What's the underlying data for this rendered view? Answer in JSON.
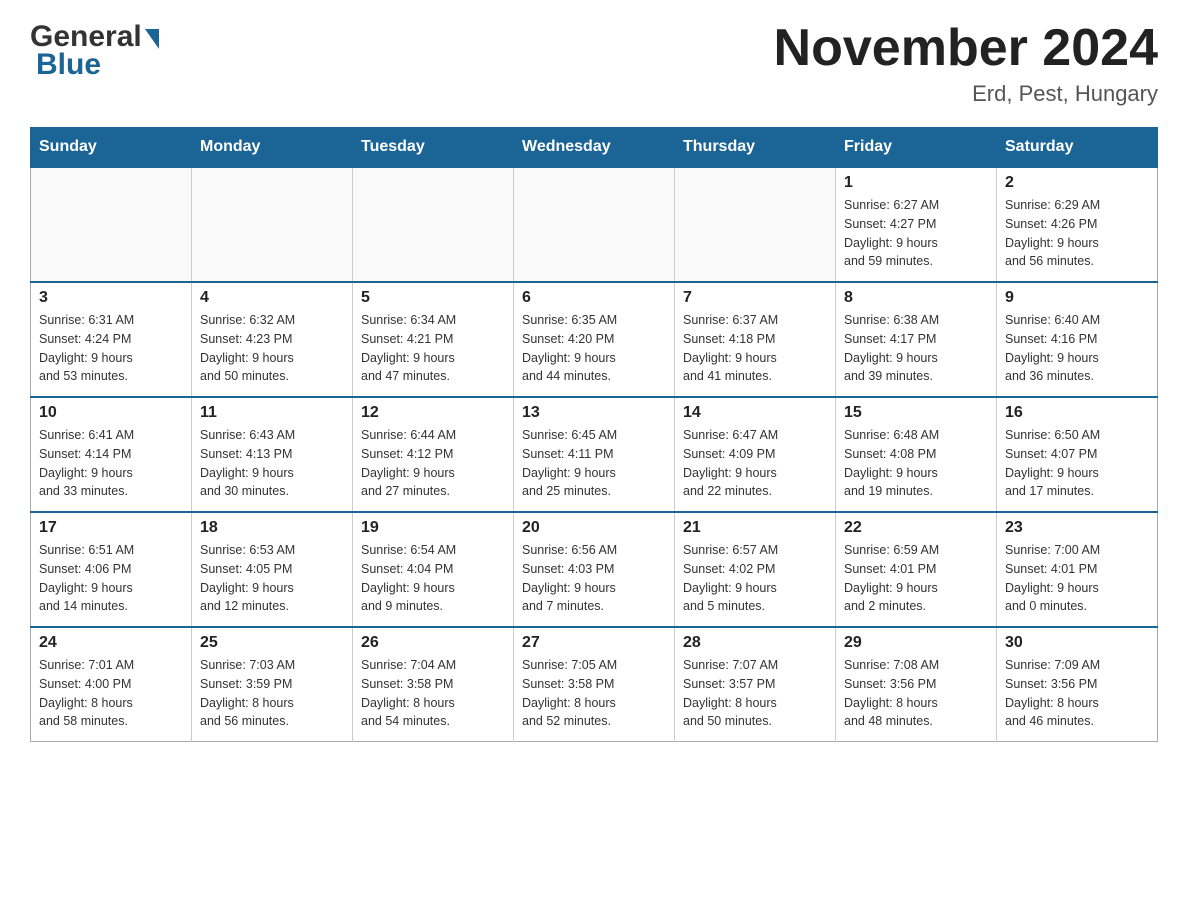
{
  "logo": {
    "text_general": "General",
    "text_blue": "Blue"
  },
  "title": "November 2024",
  "subtitle": "Erd, Pest, Hungary",
  "weekdays": [
    "Sunday",
    "Monday",
    "Tuesday",
    "Wednesday",
    "Thursday",
    "Friday",
    "Saturday"
  ],
  "weeks": [
    [
      {
        "day": "",
        "info": ""
      },
      {
        "day": "",
        "info": ""
      },
      {
        "day": "",
        "info": ""
      },
      {
        "day": "",
        "info": ""
      },
      {
        "day": "",
        "info": ""
      },
      {
        "day": "1",
        "info": "Sunrise: 6:27 AM\nSunset: 4:27 PM\nDaylight: 9 hours\nand 59 minutes."
      },
      {
        "day": "2",
        "info": "Sunrise: 6:29 AM\nSunset: 4:26 PM\nDaylight: 9 hours\nand 56 minutes."
      }
    ],
    [
      {
        "day": "3",
        "info": "Sunrise: 6:31 AM\nSunset: 4:24 PM\nDaylight: 9 hours\nand 53 minutes."
      },
      {
        "day": "4",
        "info": "Sunrise: 6:32 AM\nSunset: 4:23 PM\nDaylight: 9 hours\nand 50 minutes."
      },
      {
        "day": "5",
        "info": "Sunrise: 6:34 AM\nSunset: 4:21 PM\nDaylight: 9 hours\nand 47 minutes."
      },
      {
        "day": "6",
        "info": "Sunrise: 6:35 AM\nSunset: 4:20 PM\nDaylight: 9 hours\nand 44 minutes."
      },
      {
        "day": "7",
        "info": "Sunrise: 6:37 AM\nSunset: 4:18 PM\nDaylight: 9 hours\nand 41 minutes."
      },
      {
        "day": "8",
        "info": "Sunrise: 6:38 AM\nSunset: 4:17 PM\nDaylight: 9 hours\nand 39 minutes."
      },
      {
        "day": "9",
        "info": "Sunrise: 6:40 AM\nSunset: 4:16 PM\nDaylight: 9 hours\nand 36 minutes."
      }
    ],
    [
      {
        "day": "10",
        "info": "Sunrise: 6:41 AM\nSunset: 4:14 PM\nDaylight: 9 hours\nand 33 minutes."
      },
      {
        "day": "11",
        "info": "Sunrise: 6:43 AM\nSunset: 4:13 PM\nDaylight: 9 hours\nand 30 minutes."
      },
      {
        "day": "12",
        "info": "Sunrise: 6:44 AM\nSunset: 4:12 PM\nDaylight: 9 hours\nand 27 minutes."
      },
      {
        "day": "13",
        "info": "Sunrise: 6:45 AM\nSunset: 4:11 PM\nDaylight: 9 hours\nand 25 minutes."
      },
      {
        "day": "14",
        "info": "Sunrise: 6:47 AM\nSunset: 4:09 PM\nDaylight: 9 hours\nand 22 minutes."
      },
      {
        "day": "15",
        "info": "Sunrise: 6:48 AM\nSunset: 4:08 PM\nDaylight: 9 hours\nand 19 minutes."
      },
      {
        "day": "16",
        "info": "Sunrise: 6:50 AM\nSunset: 4:07 PM\nDaylight: 9 hours\nand 17 minutes."
      }
    ],
    [
      {
        "day": "17",
        "info": "Sunrise: 6:51 AM\nSunset: 4:06 PM\nDaylight: 9 hours\nand 14 minutes."
      },
      {
        "day": "18",
        "info": "Sunrise: 6:53 AM\nSunset: 4:05 PM\nDaylight: 9 hours\nand 12 minutes."
      },
      {
        "day": "19",
        "info": "Sunrise: 6:54 AM\nSunset: 4:04 PM\nDaylight: 9 hours\nand 9 minutes."
      },
      {
        "day": "20",
        "info": "Sunrise: 6:56 AM\nSunset: 4:03 PM\nDaylight: 9 hours\nand 7 minutes."
      },
      {
        "day": "21",
        "info": "Sunrise: 6:57 AM\nSunset: 4:02 PM\nDaylight: 9 hours\nand 5 minutes."
      },
      {
        "day": "22",
        "info": "Sunrise: 6:59 AM\nSunset: 4:01 PM\nDaylight: 9 hours\nand 2 minutes."
      },
      {
        "day": "23",
        "info": "Sunrise: 7:00 AM\nSunset: 4:01 PM\nDaylight: 9 hours\nand 0 minutes."
      }
    ],
    [
      {
        "day": "24",
        "info": "Sunrise: 7:01 AM\nSunset: 4:00 PM\nDaylight: 8 hours\nand 58 minutes."
      },
      {
        "day": "25",
        "info": "Sunrise: 7:03 AM\nSunset: 3:59 PM\nDaylight: 8 hours\nand 56 minutes."
      },
      {
        "day": "26",
        "info": "Sunrise: 7:04 AM\nSunset: 3:58 PM\nDaylight: 8 hours\nand 54 minutes."
      },
      {
        "day": "27",
        "info": "Sunrise: 7:05 AM\nSunset: 3:58 PM\nDaylight: 8 hours\nand 52 minutes."
      },
      {
        "day": "28",
        "info": "Sunrise: 7:07 AM\nSunset: 3:57 PM\nDaylight: 8 hours\nand 50 minutes."
      },
      {
        "day": "29",
        "info": "Sunrise: 7:08 AM\nSunset: 3:56 PM\nDaylight: 8 hours\nand 48 minutes."
      },
      {
        "day": "30",
        "info": "Sunrise: 7:09 AM\nSunset: 3:56 PM\nDaylight: 8 hours\nand 46 minutes."
      }
    ]
  ]
}
